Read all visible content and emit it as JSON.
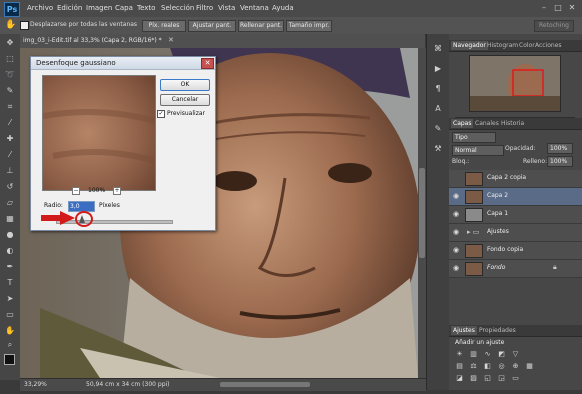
{
  "app": {
    "logo": "Ps"
  },
  "menu": [
    "Archivo",
    "Edición",
    "Imagen",
    "Capa",
    "Texto",
    "Selección",
    "Filtro",
    "Vista",
    "Ventana",
    "Ayuda"
  ],
  "window_controls": {
    "minimize": "–",
    "maximize": "□",
    "close": "✕"
  },
  "options_bar": {
    "scroll_all_label": "Desplazarse por todas las ventanas",
    "buttons": [
      "Píx. reales",
      "Ajustar pant.",
      "Rellenar pant.",
      "Tamaño impr."
    ],
    "refine_label": "Retoching"
  },
  "document": {
    "tab_title": "img_03_i-Edit.tif al 33,3% (Capa 2, RGB/16*) *",
    "status_zoom": "33,29%",
    "status_size": "50,94 cm x 34 cm (300 ppi)"
  },
  "dialog": {
    "title": "Desenfoque gaussiano",
    "close_glyph": "✕",
    "ok_label": "OK",
    "cancel_label": "Cancelar",
    "preview_label": "Previsualizar",
    "preview_checked": "✓",
    "zoom_level": "100%",
    "zoom_out": "−",
    "zoom_in": "+",
    "radius_label": "Radio:",
    "radius_value": "3,0",
    "radius_unit": "Píxeles"
  },
  "navigator": {
    "tabs": [
      "Navegador",
      "Histogram",
      "Color",
      "Acciones"
    ]
  },
  "layers_panel": {
    "tabs": [
      "Capas",
      "Canales",
      "Historia"
    ],
    "kind_label": "Tipo",
    "blend_mode": "Normal",
    "opacity_label": "Opacidad:",
    "opacity_value": "100%",
    "lock_label": "Bloq.:",
    "fill_label": "Relleno:",
    "fill_value": "100%",
    "layers": [
      {
        "name": "Capa 2 copia",
        "visible": false,
        "selected": false,
        "kind": "photo"
      },
      {
        "name": "Capa 2",
        "visible": true,
        "selected": true,
        "kind": "photo"
      },
      {
        "name": "Capa 1",
        "visible": true,
        "selected": false,
        "kind": "blank"
      },
      {
        "name": "Ajustes",
        "visible": true,
        "selected": false,
        "kind": "folder"
      },
      {
        "name": "Fondo copia",
        "visible": true,
        "selected": false,
        "kind": "photo"
      },
      {
        "name": "Fondo",
        "visible": true,
        "selected": false,
        "kind": "photo",
        "locked": true
      }
    ]
  },
  "adjustments_panel": {
    "tabs": [
      "Ajustes",
      "Propiedades"
    ],
    "heading": "Añadir un ajuste"
  },
  "icons": {
    "tools": [
      "move-icon",
      "marquee-icon",
      "lasso-icon",
      "quick-select-icon",
      "crop-icon",
      "eyedropper-icon",
      "healing-icon",
      "brush-icon",
      "clone-stamp-icon",
      "history-brush-icon",
      "eraser-icon",
      "gradient-icon",
      "blur-icon",
      "dodge-icon",
      "pen-icon",
      "type-icon",
      "path-select-icon",
      "shape-icon",
      "hand-icon",
      "zoom-icon"
    ],
    "dock": [
      "history-panel-icon",
      "actions-icon",
      "paragraph-icon",
      "character-icon",
      "brush-preset-icon",
      "tool-preset-icon"
    ]
  },
  "colors": {
    "annotation_red": "#d21a1a",
    "selected_layer": "#5a6b87",
    "ui_dark": "#3a3a3a"
  }
}
